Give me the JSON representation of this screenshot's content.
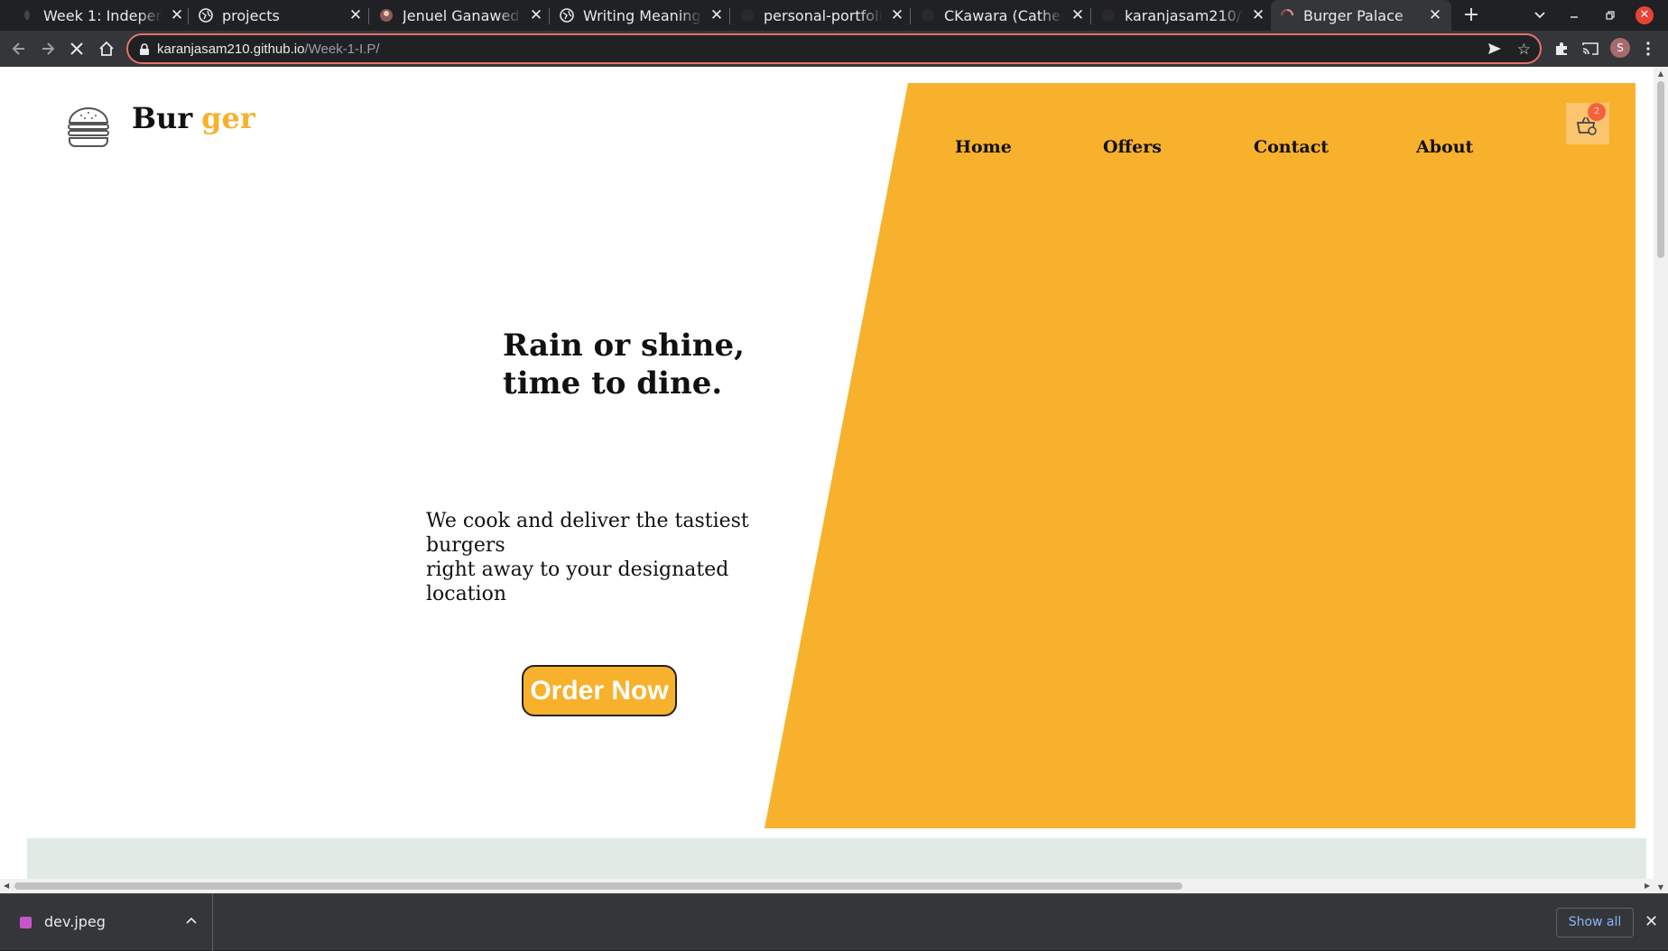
{
  "browser": {
    "tabs": [
      {
        "title": "Week 1: Independen",
        "favicon": "leaf-icon",
        "active": false
      },
      {
        "title": "projects",
        "favicon": "globe-icon",
        "active": false
      },
      {
        "title": "Jenuel Ganawed",
        "favicon": "avatar-icon",
        "active": false
      },
      {
        "title": "Writing Meaningful",
        "favicon": "globe-icon",
        "active": false
      },
      {
        "title": "personal-portfolio/i",
        "favicon": "github-icon",
        "active": false
      },
      {
        "title": "CKawara (Catherine",
        "favicon": "github-icon",
        "active": false
      },
      {
        "title": "karanjasam210/We",
        "favicon": "github-icon",
        "active": false
      },
      {
        "title": "Burger Palace",
        "favicon": "loading-spinner-icon",
        "active": true
      }
    ],
    "tab_close": "✕",
    "new_tab": "+",
    "url_host": "karanjasam210.github.io",
    "url_path": "/Week-1-I.P/",
    "profile_initial": "S"
  },
  "page": {
    "brand_part1": "Bur",
    "brand_part2": "ger",
    "nav": [
      "Home",
      "Offers",
      "Contact",
      "About"
    ],
    "cart_count": "2",
    "hero_title_line1": "Rain or shine,",
    "hero_title_line2": "time to dine.",
    "hero_sub_line1": "We cook and deliver the tastiest burgers",
    "hero_sub_line2": "right away to your designated location",
    "cta_label": "Order Now",
    "colors": {
      "accent": "#f8b12c",
      "section_bg": "#e0ebe5",
      "badge": "#f5623b"
    }
  },
  "downloads": {
    "file_name": "dev.jpeg",
    "show_all": "Show all"
  }
}
